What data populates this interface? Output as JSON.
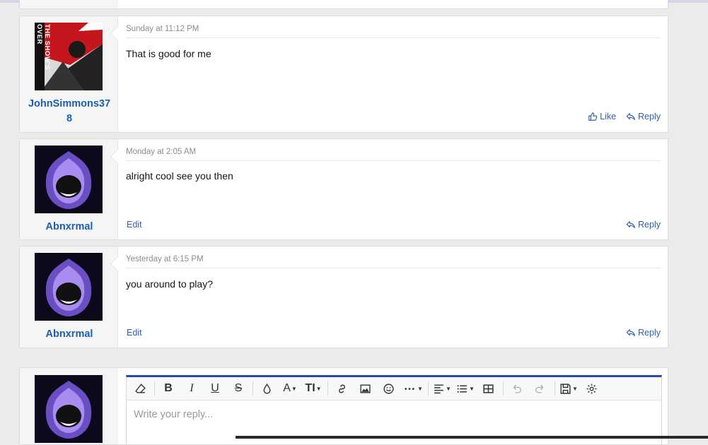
{
  "messages": [
    {
      "username": "JohnSimmons378",
      "username_line1": "JohnSimmons37",
      "username_line2": "8",
      "timestamp": "Sunday at 11:12 PM",
      "text": "That is good for me",
      "like_label": "Like",
      "reply_label": "Reply",
      "avatar_text": "THE SHOW'S OVER"
    },
    {
      "username": "Abnxrmal",
      "timestamp": "Monday at 2:05 AM",
      "text": "alright cool see you then",
      "edit_label": "Edit",
      "reply_label": "Reply"
    },
    {
      "username": "Abnxrmal",
      "timestamp": "Yesterday at 6:15 PM",
      "text": "you around to play?",
      "edit_label": "Edit",
      "reply_label": "Reply"
    }
  ],
  "editor": {
    "placeholder": "Write your reply...",
    "toolbar_icons": [
      "eraser-icon",
      "bold-icon",
      "italic-icon",
      "underline-icon",
      "strikethrough-icon",
      "color-icon",
      "font-family-icon",
      "font-size-icon",
      "link-icon",
      "image-icon",
      "emoji-icon",
      "more-icon",
      "align-icon",
      "list-icon",
      "table-icon",
      "undo-icon",
      "redo-icon",
      "drafts-icon",
      "settings-icon"
    ],
    "bold_glyph": "B",
    "italic_glyph": "I",
    "underline_glyph": "U",
    "strike_glyph": "S",
    "font_glyph": "A",
    "size_glyph": "TI"
  },
  "colors": {
    "accent": "#1e4fb0",
    "link": "#2f5fa8",
    "username": "#1b5fb5"
  }
}
